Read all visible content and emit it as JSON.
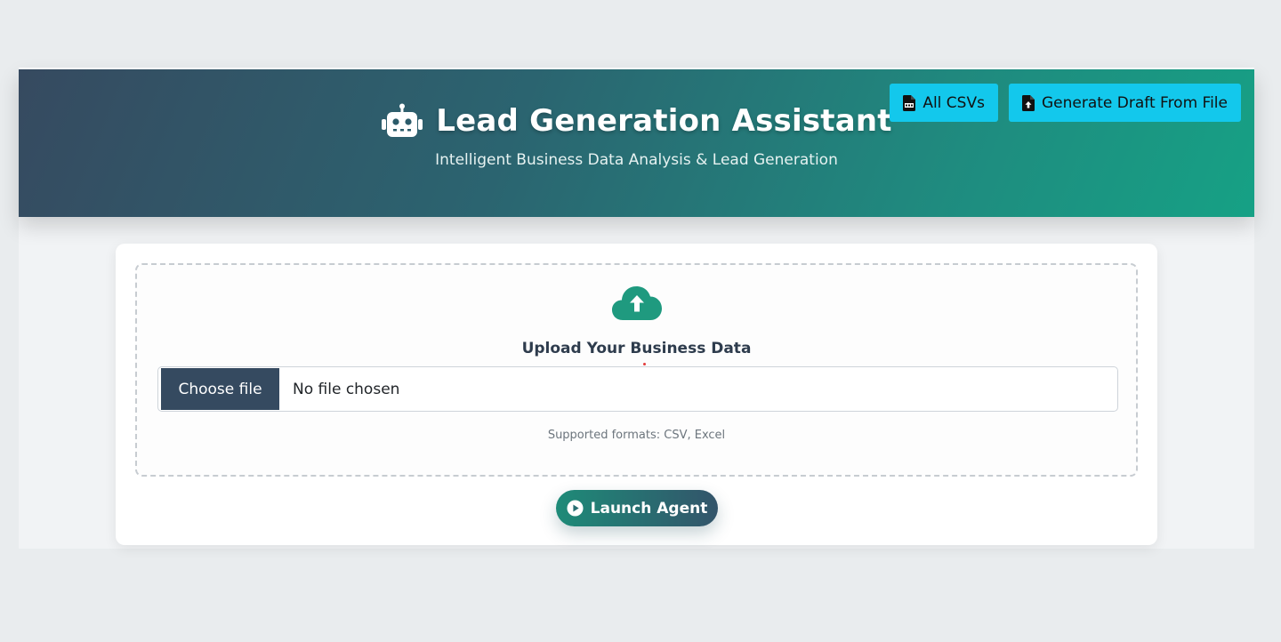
{
  "header": {
    "title": "Lead Generation Assistant",
    "subtitle": "Intelligent Business Data Analysis & Lead Generation",
    "icon": "robot-icon",
    "buttons": [
      {
        "label": "All CSVs",
        "icon": "csv-file-icon"
      },
      {
        "label": "Generate Draft From File",
        "icon": "file-upload-icon"
      }
    ]
  },
  "upload": {
    "icon": "cloud-upload-icon",
    "title": "Upload Your Business Data",
    "choose_label": "Choose file",
    "file_status": "No file chosen",
    "formats": "Supported formats: CSV, Excel"
  },
  "launch": {
    "label": "Launch Agent",
    "icon": "play-circle-icon"
  },
  "colors": {
    "header_gradient_start": "#364a60",
    "header_gradient_end": "#16a185",
    "header_button": "#13c8ec",
    "accent_green": "#1f9a7f",
    "choose_button": "#354a60"
  }
}
